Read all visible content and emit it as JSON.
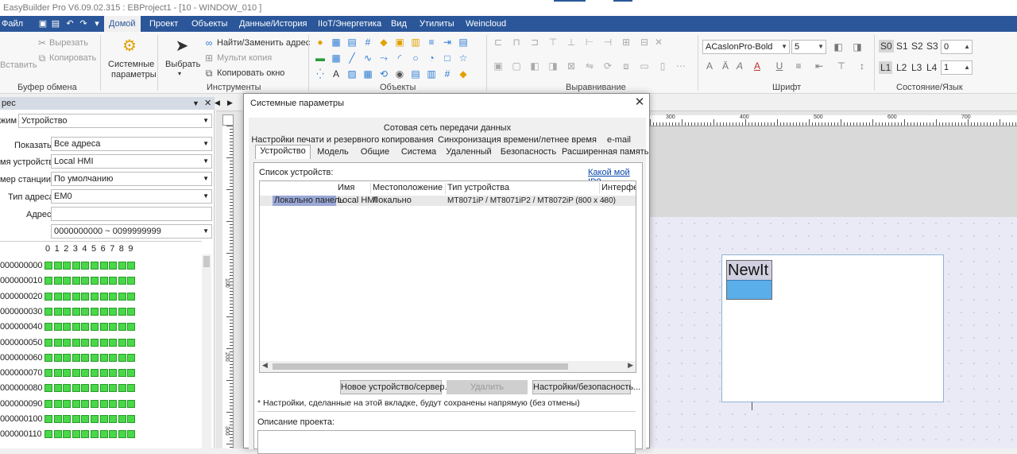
{
  "titlebar": {
    "text": "EasyBuilder Pro V6.09.02.315 : EBProject1 - [10 - WINDOW_010 ]"
  },
  "menu": {
    "items": [
      "Файл",
      "Домой",
      "Проект",
      "Объекты",
      "Данные/История",
      "IIoT/Энергетика",
      "Вид",
      "Утилиты",
      "Weincloud"
    ],
    "active": "Домой"
  },
  "ribbon": {
    "clipboard": {
      "paste": "Вставить",
      "cut": "Вырезать",
      "copy": "Копировать",
      "group": "Буфер обмена"
    },
    "sysparams": {
      "label1": "Системные",
      "label2": "параметры"
    },
    "tools": {
      "select": "Выбрать",
      "find": "Найти/Заменить адрес",
      "multicopy": "Мульти копия",
      "copywin": "Копировать окно",
      "group": "Инструменты"
    },
    "objects": {
      "group": "Объекты"
    },
    "align": {
      "group": "Выравнивание"
    },
    "font": {
      "name": "ACaslonPro-Bold",
      "size": "5",
      "group": "Шрифт"
    },
    "state": {
      "s0": "S0",
      "s1": "S1",
      "s2": "S2",
      "s3": "S3",
      "s_value": "0",
      "l1": "L1",
      "l2": "L2",
      "l3": "L3",
      "l4": "L4",
      "l_value": "1",
      "group": "Состояние/Язык"
    }
  },
  "leftpanel": {
    "header": "рес",
    "mode_label": "жим",
    "mode_value": "Устройство",
    "show_label": "Показать",
    "show_value": "Все адреса",
    "device_label": "мя устройства",
    "device_value": "Local HMI",
    "station_label": "мер станции.",
    "station_value": "По умолчанию",
    "addrtype_label": "Тип адреса",
    "addrtype_value": "EM0",
    "address_label": "Адрес",
    "address_value": "",
    "range_value": "0000000000 ~ 0099999999",
    "bit_header": [
      "0",
      "1",
      "2",
      "3",
      "4",
      "5",
      "6",
      "7",
      "8",
      "9"
    ],
    "rows": [
      "000000000",
      "000000010",
      "000000020",
      "000000030",
      "000000040",
      "000000050",
      "000000060",
      "000000070",
      "000000080",
      "000000090",
      "000000100",
      "000000110"
    ]
  },
  "ruler": {
    "top_labels": [
      "300",
      "400",
      "500",
      "600",
      "700"
    ],
    "left_labels": [
      "100",
      "200",
      "300"
    ]
  },
  "canvas": {
    "object_text": "NewIt"
  },
  "dialog": {
    "title": "Системные параметры",
    "tabs_row1": [
      "Сотовая сеть передачи данных"
    ],
    "tabs_row2": [
      "Настройки печати и резервного копирования",
      "Синхронизация времени/летнее время",
      "e-mail"
    ],
    "tabs_row3": [
      "Устройство",
      "Модель",
      "Общие",
      "Система",
      "Удаленный",
      "Безопасность",
      "Расширенная память"
    ],
    "selected_tab": "Устройство",
    "devlist_label": "Список устройств:",
    "which_ip": "Какой мой IP?",
    "columns": [
      "Имя",
      "Местоположение",
      "Тип устройства",
      "Интерфе"
    ],
    "rows": [
      {
        "panel": "Локально панель",
        "name": "Local HMI",
        "location": "Локально",
        "type": "MT8071iP / MT8071iP2 / MT8072iP (800 x 480)",
        "iface": "-"
      }
    ],
    "buttons": {
      "new": "Новое устройство/сервер...",
      "delete": "Удалить",
      "settings": "Настройки/безопасность..."
    },
    "note": "* Настройки, сделанные на этой вкладке, будут сохранены напрямую (без отмены)",
    "desc_label": "Описание проекта:"
  },
  "colors": {
    "menu_bg": "#2b579a",
    "bit_on": "#48d848",
    "object_button": "#5aaeea",
    "highlight": "#9aa8d6"
  }
}
